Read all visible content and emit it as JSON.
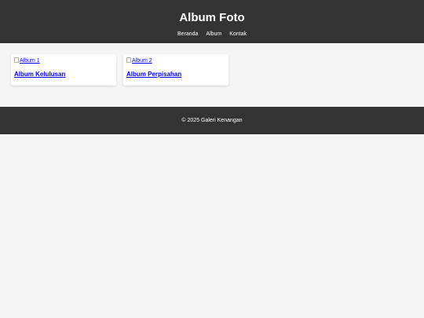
{
  "header": {
    "title": "Album Foto",
    "nav": [
      "Beranda",
      "Album",
      "Kontak"
    ]
  },
  "albums": [
    {
      "image_alt": "Album 1",
      "title": "Album Kelulusan"
    },
    {
      "image_alt": "Album 2",
      "title": "Album Perpisahan"
    }
  ],
  "footer": {
    "text": "© 2025 Galeri Kenangan"
  },
  "colors": {
    "header_bg": "#333333",
    "page_bg": "#f5f5f5",
    "link": "#0000ee"
  }
}
